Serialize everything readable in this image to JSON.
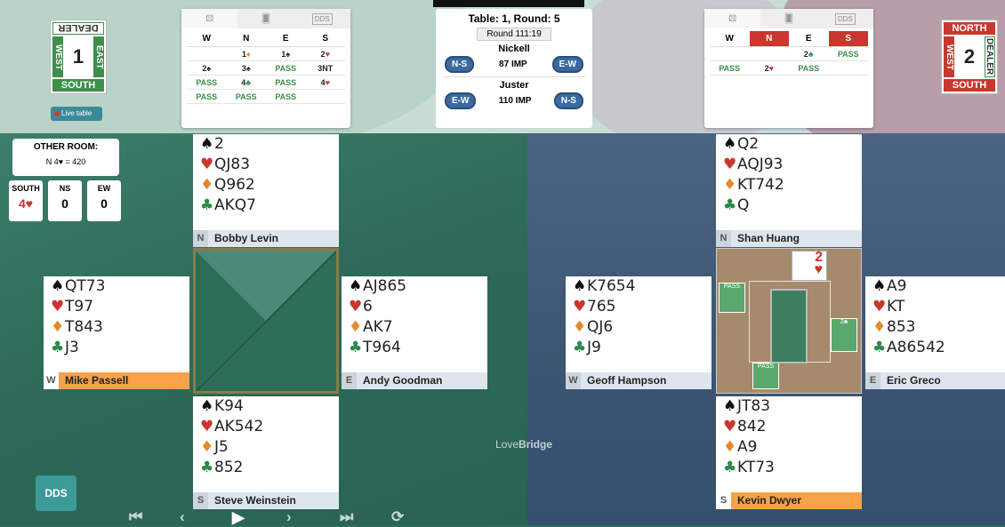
{
  "left_dealer": {
    "top": "DEALER",
    "left": "WEST",
    "right": "EAST",
    "bottom": "SOUTH",
    "number": "1"
  },
  "live_table": "Live table",
  "right_dealer": {
    "top": "NORTH",
    "left": "WEST",
    "right": "DEALER",
    "bottom": "SOUTH",
    "number": "2"
  },
  "dds_tab": "DDS",
  "bidding_left": {
    "headers": [
      "W",
      "N",
      "E",
      "S"
    ],
    "rows": [
      [
        "",
        "1♦",
        "1♠",
        "2♥"
      ],
      [
        "2♠",
        "3♠",
        "PASS",
        "3NT"
      ],
      [
        "PASS",
        "4♣",
        "PASS",
        "4♥"
      ],
      [
        "PASS",
        "PASS",
        "PASS",
        ""
      ]
    ]
  },
  "bidding_right": {
    "headers": [
      "W",
      "N",
      "E",
      "S"
    ],
    "rows": [
      [
        "",
        "",
        "2♣",
        "PASS"
      ],
      [
        "PASS",
        "2♥",
        "PASS",
        ""
      ]
    ]
  },
  "table_info": {
    "title": "Table: 1, Round: 5",
    "round": "Round  111:19",
    "team1": "Nickell",
    "team1_left": "N-S",
    "team1_imp": "87 IMP",
    "team1_right": "E-W",
    "team2": "Juster",
    "team2_left": "E-W",
    "team2_imp": "110 IMP",
    "team2_right": "N-S"
  },
  "other_room": {
    "label": "OTHER ROOM:",
    "result": "N 4♥ = 420"
  },
  "scores": [
    {
      "label": "SOUTH",
      "value": "4♥"
    },
    {
      "label": "NS",
      "value": "0"
    },
    {
      "label": "EW",
      "value": "0"
    }
  ],
  "hands": {
    "t1_north": {
      "s": "2",
      "h": "QJ83",
      "d": "Q962",
      "c": "AKQ7",
      "dir": "N",
      "name": "Bobby Levin"
    },
    "t1_west": {
      "s": "QT73",
      "h": "T97",
      "d": "T843",
      "c": "J3",
      "dir": "W",
      "name": "Mike Passell"
    },
    "t1_east": {
      "s": "AJ865",
      "h": "6",
      "d": "AK7",
      "c": "T964",
      "dir": "E",
      "name": "Andy Goodman"
    },
    "t1_south": {
      "s": "K94",
      "h": "AK542",
      "d": "J5",
      "c": "852",
      "dir": "S",
      "name": "Steve Weinstein"
    },
    "t2_north": {
      "s": "Q2",
      "h": "AQJ93",
      "d": "KT742",
      "c": "Q",
      "dir": "N",
      "name": "Shan Huang"
    },
    "t2_west": {
      "s": "K7654",
      "h": "765",
      "d": "QJ6",
      "c": "J9",
      "dir": "W",
      "name": "Geoff Hampson"
    },
    "t2_east": {
      "s": "A9",
      "h": "KT",
      "d": "853",
      "c": "A86542",
      "dir": "E",
      "name": "Eric Greco"
    },
    "t2_south": {
      "s": "JT83",
      "h": "842",
      "d": "A9",
      "c": "KT73",
      "dir": "S",
      "name": "Kevin Dwyer"
    }
  },
  "played_card": {
    "rank": "2",
    "suit": "♥"
  },
  "logo": {
    "a": "Love",
    "b": "Bridge"
  },
  "dds_button": "DDS",
  "colors": {
    "green": "#3d8f4b",
    "red": "#c9372e",
    "active_player": "#f5a24a"
  }
}
